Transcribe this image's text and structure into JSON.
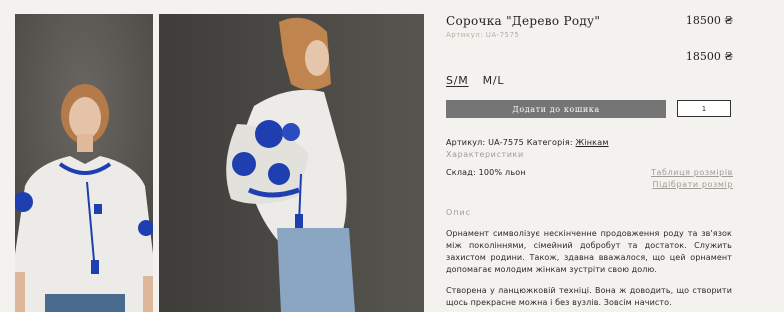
{
  "product": {
    "title": "Сорочка \"Дерево Роду\"",
    "price": "18500 ₴",
    "sku_subtitle": "Артикул: UA-7575",
    "price_repeat": "18500 ₴"
  },
  "sizes": [
    {
      "label": "S/M",
      "selected": true
    },
    {
      "label": "M/L",
      "selected": false
    }
  ],
  "cart": {
    "add_label": "Додати до кошика",
    "quantity": "1"
  },
  "meta": {
    "sku_label": "Артикул: UA-7575",
    "category_label": "Категорія:",
    "category_link": "Жінкам"
  },
  "characteristics_label": "Характеристики",
  "fabric": "Склад: 100% льон",
  "links": {
    "size_table": "Таблиця розмірів",
    "pick_size": "Підібрати розмір"
  },
  "description": {
    "heading": "Опис",
    "paragraph1": "Орнамент символізує нескінченне продовження роду та зв'язок між поколіннями, сімейний добробут та достаток. Служить захистом родини. Також, здавна вважалося, що цей орнамент допомагає молодим жінкам зустріти свою долю.",
    "paragraph2": "Створена у ланцюжковій техніці. Вона ж доводить, що створити щось прекрасне можна і без вузлів. Зовсім начисто."
  },
  "colors": {
    "background": "#f4f2ee",
    "button": "#757575",
    "embroidery": "#1f3fb0",
    "muted_text": "#9f9c96"
  }
}
